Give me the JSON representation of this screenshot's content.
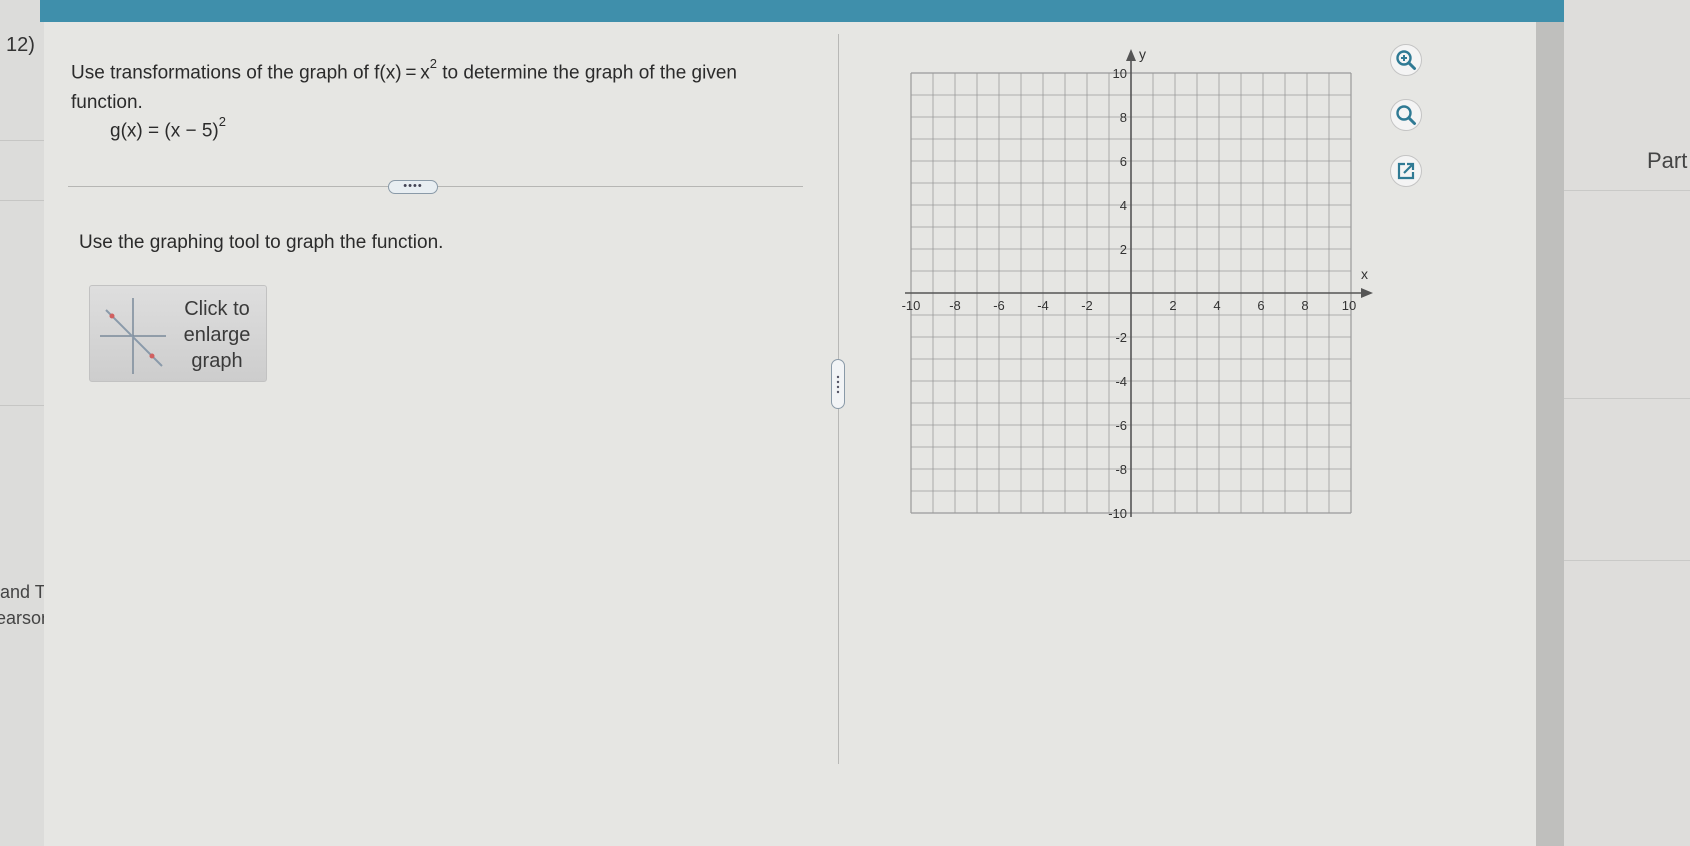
{
  "question": {
    "number": "12)",
    "prompt_before": "Use transformations of the graph of f(x) = x",
    "prompt_exp": "2",
    "prompt_after": " to determine the graph of the given function.",
    "given_function": "g(x) = (x − 5)",
    "given_exp": "2",
    "more_label": "••••",
    "instruction": "Use the graphing tool to graph the function.",
    "enlarge_label": "Click to enlarge graph"
  },
  "left_fragments": [
    "and Thu",
    "earson Ed"
  ],
  "right_fragment": "Part",
  "graph": {
    "x_label": "x",
    "y_label": "y",
    "x_min": -10,
    "x_max": 10,
    "y_min": -10,
    "y_max": 10,
    "grid_step": 1,
    "x_tick_labels": [
      "-10",
      "-8",
      "-6",
      "-4",
      "-2",
      "2",
      "4",
      "6",
      "8",
      "10"
    ],
    "y_tick_labels": [
      "10",
      "8",
      "6",
      "4",
      "2",
      "-2",
      "-4",
      "-6",
      "-8",
      "-10"
    ]
  },
  "tools": [
    "zoom-in-icon",
    "zoom-out-icon",
    "open-new-window-icon"
  ],
  "colors": {
    "topbar": "#3f8fab",
    "grid": "#9a9a9a",
    "axis": "#555555"
  }
}
